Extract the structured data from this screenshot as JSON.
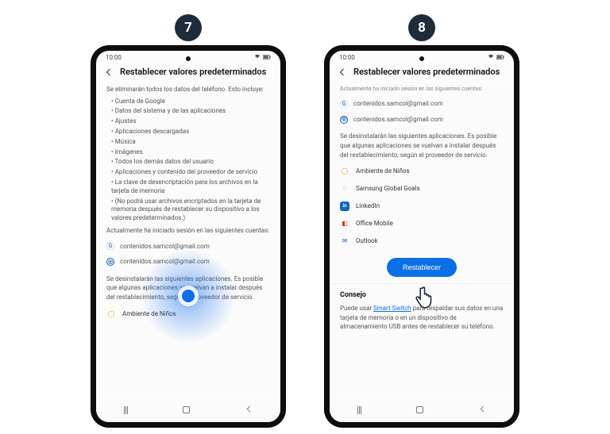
{
  "steps": [
    {
      "badge": "7"
    },
    {
      "badge": "8"
    }
  ],
  "statusbar": {
    "time": "10:00"
  },
  "header": {
    "title": "Restablecer valores predeterminados"
  },
  "screen7": {
    "intro": "Se eliminarán todos los datos del teléfono. Esto incluye:",
    "bullets": [
      "Cuenta de Google",
      "Datos del sistema y de las aplicaciones",
      "Ajustes",
      "Aplicaciones descargadas",
      "Música",
      "Imágenes",
      "Todos los demás datos del usuario",
      "Aplicaciones y contenido del proveedor de servicio",
      "La clave de desencriptación para los archivos en la tarjeta de memoria"
    ],
    "disabled_note": "(No podrá usar archivos encriptados en la tarjeta de memoria después de restablecer su dispositivo a los valores predeterminados.)",
    "session_note": "Actualmente ha iniciado sesión en las siguientes cuentas:",
    "accounts": [
      {
        "icon": "g",
        "email": "contenidos.samcol@gmail.com"
      },
      {
        "icon": "s",
        "email": "contenidos.samcol@gmail.com"
      }
    ],
    "apps_note": "Se desinstalarán las siguientes aplicaciones. Es posible que algunas aplicaciones se vuelvan a instalar después del restablecimiento, según el proveedor de servicio.",
    "apps": [
      {
        "key": "kids",
        "name": "Ambiente de Niños"
      }
    ]
  },
  "screen8": {
    "top_line": "Actualmente ha iniciado sesión en las siguientes cuentas:",
    "accounts": [
      {
        "icon": "g",
        "email": "contenidos.samcol@gmail.com"
      },
      {
        "icon": "s",
        "email": "contenidos.samcol@gmail.com"
      }
    ],
    "apps_note": "Se desinstalarán las siguientes aplicaciones. Es posible que algunas aplicaciones se vuelvan a instalar después del restablecimiento, según el proveedor de servicio.",
    "apps": [
      {
        "key": "kids",
        "name": "Ambiente de Niños"
      },
      {
        "key": "goals",
        "name": "Samsung Global Goals"
      },
      {
        "key": "linkedin",
        "name": "LinkedIn"
      },
      {
        "key": "office",
        "name": "Office Mobile"
      },
      {
        "key": "outlook",
        "name": "Outlook"
      }
    ],
    "button": "Restablecer",
    "tip_title": "Consejo",
    "tip_pre": "Puede usar ",
    "tip_link": "Smart Switch",
    "tip_post": " para respaldar sus datos en una tarjeta de memoria o en un dispositivo de almacenamiento USB antes de restablecer su teléfono."
  }
}
